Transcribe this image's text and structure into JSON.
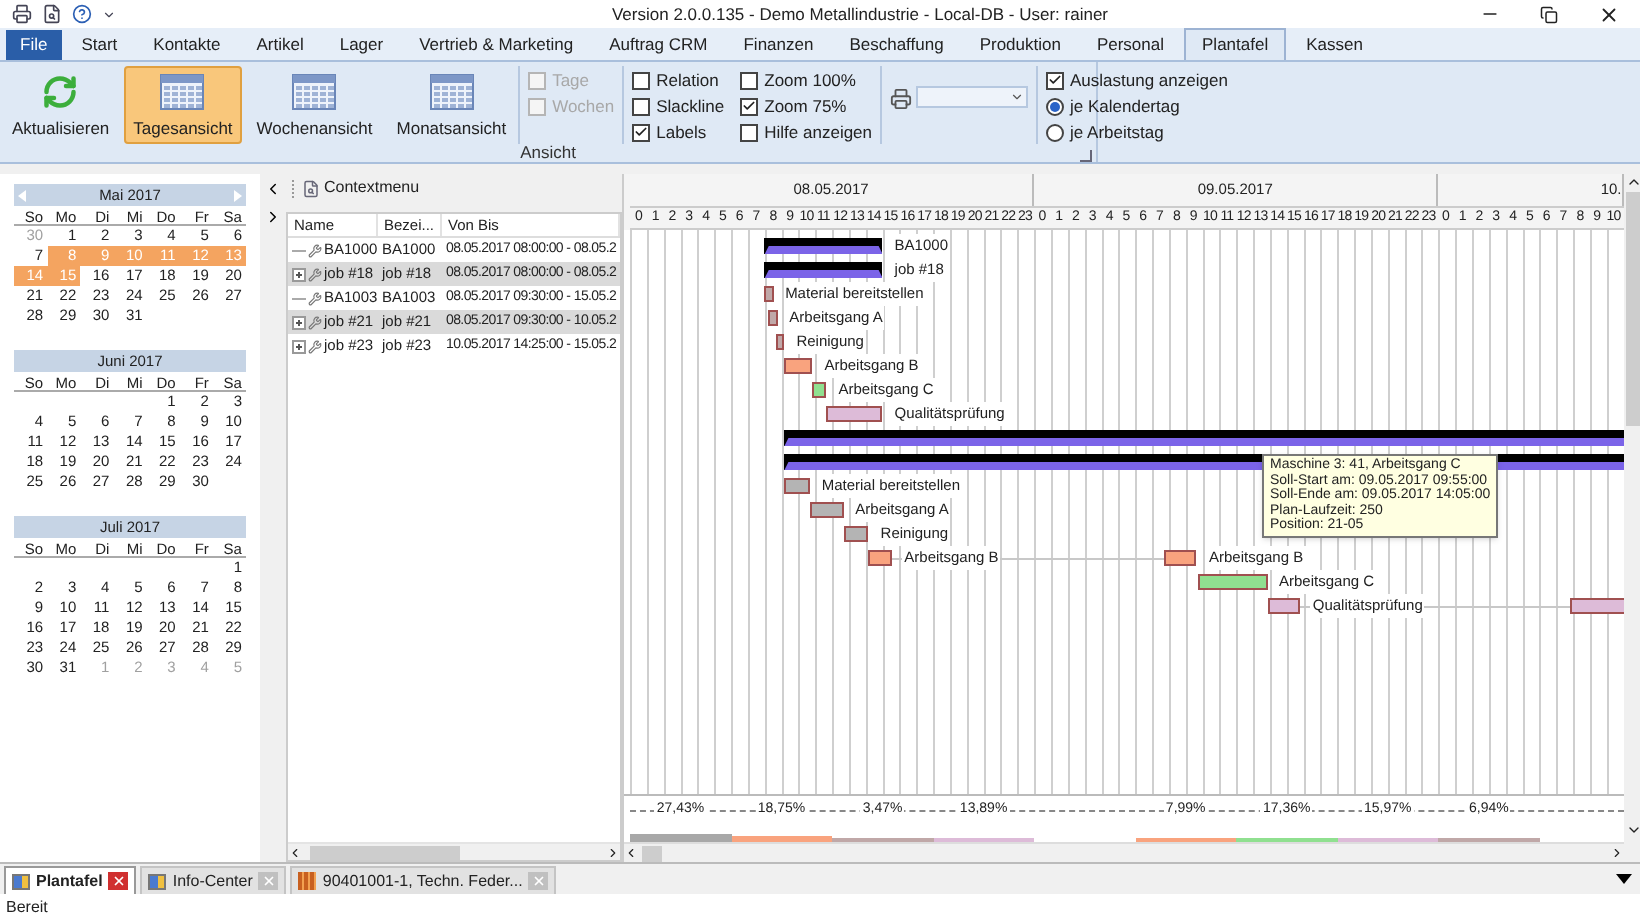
{
  "window": {
    "title": "Version 2.0.0.135 - Demo Metallindustrie - Local-DB - User: rainer"
  },
  "menu_tabs": [
    {
      "label": "File",
      "kind": "file",
      "selected": false
    },
    {
      "label": "Start",
      "kind": "tab",
      "selected": false
    },
    {
      "label": "Kontakte",
      "kind": "tab",
      "selected": false
    },
    {
      "label": "Artikel",
      "kind": "tab",
      "selected": false
    },
    {
      "label": "Lager",
      "kind": "tab",
      "selected": false
    },
    {
      "label": "Vertrieb & Marketing",
      "kind": "tab",
      "selected": false
    },
    {
      "label": "Auftrag CRM",
      "kind": "tab",
      "selected": false
    },
    {
      "label": "Finanzen",
      "kind": "tab",
      "selected": false
    },
    {
      "label": "Beschaffung",
      "kind": "tab",
      "selected": false
    },
    {
      "label": "Produktion",
      "kind": "tab",
      "selected": false
    },
    {
      "label": "Personal",
      "kind": "tab",
      "selected": false
    },
    {
      "label": "Plantafel",
      "kind": "tab",
      "selected": true
    },
    {
      "label": "Kassen",
      "kind": "tab",
      "selected": false
    }
  ],
  "ribbon": {
    "group_label": "Ansicht",
    "buttons": [
      {
        "label": "Aktualisieren",
        "kind": "refresh",
        "selected": false
      },
      {
        "label": "Tagesansicht",
        "kind": "calendar",
        "selected": true
      },
      {
        "label": "Wochenansicht",
        "kind": "calendar",
        "selected": false
      },
      {
        "label": "Monatsansicht",
        "kind": "calendar",
        "selected": false
      }
    ],
    "checkbox_columns": [
      [
        {
          "label": "Tage",
          "checked": false,
          "disabled": true
        },
        {
          "label": "Wochen",
          "checked": false,
          "disabled": true
        }
      ],
      [
        {
          "label": "Relation",
          "checked": false,
          "disabled": false
        },
        {
          "label": "Slackline",
          "checked": false,
          "disabled": false
        },
        {
          "label": "Labels",
          "checked": true,
          "disabled": false
        }
      ],
      [
        {
          "label": "Zoom 100%",
          "checked": false,
          "disabled": false
        },
        {
          "label": "Zoom 75%",
          "checked": true,
          "disabled": false
        },
        {
          "label": "Hilfe anzeigen",
          "checked": false,
          "disabled": false
        }
      ]
    ],
    "utilization": {
      "label": "Auslastung anzeigen",
      "checked": true
    },
    "radios": [
      {
        "label": "je Kalendertag",
        "selected": true
      },
      {
        "label": "je Arbeitstag",
        "selected": false
      }
    ]
  },
  "calendar": [
    {
      "title": "Mai 2017",
      "navigation": true,
      "weekdays": [
        "So",
        "Mo",
        "Di",
        "Mi",
        "Do",
        "Fr",
        "Sa"
      ],
      "weeks": [
        [
          {
            "day": "30",
            "muted": true,
            "selected": false
          },
          {
            "day": "1",
            "muted": false,
            "selected": false
          },
          {
            "day": "2",
            "muted": false,
            "selected": false
          },
          {
            "day": "3",
            "muted": false,
            "selected": false
          },
          {
            "day": "4",
            "muted": false,
            "selected": false
          },
          {
            "day": "5",
            "muted": false,
            "selected": false
          },
          {
            "day": "6",
            "muted": false,
            "selected": false
          }
        ],
        [
          {
            "day": "7",
            "muted": false,
            "selected": false
          },
          {
            "day": "8",
            "muted": false,
            "selected": true
          },
          {
            "day": "9",
            "muted": false,
            "selected": true
          },
          {
            "day": "10",
            "muted": false,
            "selected": true
          },
          {
            "day": "11",
            "muted": false,
            "selected": true
          },
          {
            "day": "12",
            "muted": false,
            "selected": true
          },
          {
            "day": "13",
            "muted": false,
            "selected": true
          }
        ],
        [
          {
            "day": "14",
            "muted": false,
            "selected": true
          },
          {
            "day": "15",
            "muted": false,
            "selected": true
          },
          {
            "day": "16",
            "muted": false,
            "selected": false
          },
          {
            "day": "17",
            "muted": false,
            "selected": false
          },
          {
            "day": "18",
            "muted": false,
            "selected": false
          },
          {
            "day": "19",
            "muted": false,
            "selected": false
          },
          {
            "day": "20",
            "muted": false,
            "selected": false
          }
        ],
        [
          {
            "day": "21",
            "muted": false,
            "selected": false
          },
          {
            "day": "22",
            "muted": false,
            "selected": false
          },
          {
            "day": "23",
            "muted": false,
            "selected": false
          },
          {
            "day": "24",
            "muted": false,
            "selected": false
          },
          {
            "day": "25",
            "muted": false,
            "selected": false
          },
          {
            "day": "26",
            "muted": false,
            "selected": false
          },
          {
            "day": "27",
            "muted": false,
            "selected": false
          }
        ],
        [
          {
            "day": "28",
            "muted": false,
            "selected": false
          },
          {
            "day": "29",
            "muted": false,
            "selected": false
          },
          {
            "day": "30",
            "muted": false,
            "selected": false
          },
          {
            "day": "31",
            "muted": false,
            "selected": false
          }
        ]
      ]
    },
    {
      "title": "Juni 2017",
      "navigation": false,
      "weekdays": [
        "So",
        "Mo",
        "Di",
        "Mi",
        "Do",
        "Fr",
        "Sa"
      ],
      "weeks": [
        [
          {
            "day": "1",
            "muted": false,
            "selected": false
          },
          {
            "day": "2",
            "muted": false,
            "selected": false
          },
          {
            "day": "3",
            "muted": false,
            "selected": false
          }
        ],
        [
          {
            "day": "4",
            "muted": false,
            "selected": false
          },
          {
            "day": "5",
            "muted": false,
            "selected": false
          },
          {
            "day": "6",
            "muted": false,
            "selected": false
          },
          {
            "day": "7",
            "muted": false,
            "selected": false
          },
          {
            "day": "8",
            "muted": false,
            "selected": false
          },
          {
            "day": "9",
            "muted": false,
            "selected": false
          },
          {
            "day": "10",
            "muted": false,
            "selected": false
          }
        ],
        [
          {
            "day": "11",
            "muted": false,
            "selected": false
          },
          {
            "day": "12",
            "muted": false,
            "selected": false
          },
          {
            "day": "13",
            "muted": false,
            "selected": false
          },
          {
            "day": "14",
            "muted": false,
            "selected": false
          },
          {
            "day": "15",
            "muted": false,
            "selected": false
          },
          {
            "day": "16",
            "muted": false,
            "selected": false
          },
          {
            "day": "17",
            "muted": false,
            "selected": false
          }
        ],
        [
          {
            "day": "18",
            "muted": false,
            "selected": false
          },
          {
            "day": "19",
            "muted": false,
            "selected": false
          },
          {
            "day": "20",
            "muted": false,
            "selected": false
          },
          {
            "day": "21",
            "muted": false,
            "selected": false
          },
          {
            "day": "22",
            "muted": false,
            "selected": false
          },
          {
            "day": "23",
            "muted": false,
            "selected": false
          },
          {
            "day": "24",
            "muted": false,
            "selected": false
          }
        ],
        [
          {
            "day": "25",
            "muted": false,
            "selected": false
          },
          {
            "day": "26",
            "muted": false,
            "selected": false
          },
          {
            "day": "27",
            "muted": false,
            "selected": false
          },
          {
            "day": "28",
            "muted": false,
            "selected": false
          },
          {
            "day": "29",
            "muted": false,
            "selected": false
          },
          {
            "day": "30",
            "muted": false,
            "selected": false
          }
        ]
      ]
    },
    {
      "title": "Juli 2017",
      "navigation": false,
      "weekdays": [
        "So",
        "Mo",
        "Di",
        "Mi",
        "Do",
        "Fr",
        "Sa"
      ],
      "weeks": [
        [
          {
            "day": "1",
            "muted": false,
            "selected": false
          }
        ],
        [
          {
            "day": "2",
            "muted": false,
            "selected": false
          },
          {
            "day": "3",
            "muted": false,
            "selected": false
          },
          {
            "day": "4",
            "muted": false,
            "selected": false
          },
          {
            "day": "5",
            "muted": false,
            "selected": false
          },
          {
            "day": "6",
            "muted": false,
            "selected": false
          },
          {
            "day": "7",
            "muted": false,
            "selected": false
          },
          {
            "day": "8",
            "muted": false,
            "selected": false
          }
        ],
        [
          {
            "day": "9",
            "muted": false,
            "selected": false
          },
          {
            "day": "10",
            "muted": false,
            "selected": false
          },
          {
            "day": "11",
            "muted": false,
            "selected": false
          },
          {
            "day": "12",
            "muted": false,
            "selected": false
          },
          {
            "day": "13",
            "muted": false,
            "selected": false
          },
          {
            "day": "14",
            "muted": false,
            "selected": false
          },
          {
            "day": "15",
            "muted": false,
            "selected": false
          }
        ],
        [
          {
            "day": "16",
            "muted": false,
            "selected": false
          },
          {
            "day": "17",
            "muted": false,
            "selected": false
          },
          {
            "day": "18",
            "muted": false,
            "selected": false
          },
          {
            "day": "19",
            "muted": false,
            "selected": false
          },
          {
            "day": "20",
            "muted": false,
            "selected": false
          },
          {
            "day": "21",
            "muted": false,
            "selected": false
          },
          {
            "day": "22",
            "muted": false,
            "selected": false
          }
        ],
        [
          {
            "day": "23",
            "muted": false,
            "selected": false
          },
          {
            "day": "24",
            "muted": false,
            "selected": false
          },
          {
            "day": "25",
            "muted": false,
            "selected": false
          },
          {
            "day": "26",
            "muted": false,
            "selected": false
          },
          {
            "day": "27",
            "muted": false,
            "selected": false
          },
          {
            "day": "28",
            "muted": false,
            "selected": false
          },
          {
            "day": "29",
            "muted": false,
            "selected": false
          }
        ],
        [
          {
            "day": "30",
            "muted": false,
            "selected": false
          },
          {
            "day": "31",
            "muted": false,
            "selected": false
          },
          {
            "day": "1",
            "muted": true,
            "selected": false
          },
          {
            "day": "2",
            "muted": true,
            "selected": false
          },
          {
            "day": "3",
            "muted": true,
            "selected": false
          },
          {
            "day": "4",
            "muted": true,
            "selected": false
          },
          {
            "day": "5",
            "muted": true,
            "selected": false
          }
        ]
      ]
    }
  ],
  "tree": {
    "toolbar": "Contextmenu",
    "columns": [
      "Name",
      "Bezei...",
      "Von Bis"
    ],
    "rows": [
      {
        "name": "BA1000",
        "label": "BA1000",
        "period": "08.05.2017 08:00:00 - 08.05.2",
        "expandable": false,
        "selected": false
      },
      {
        "name": "job #18",
        "label": "job #18",
        "period": "08.05.2017 08:00:00 - 08.05.2",
        "expandable": true,
        "selected": true
      },
      {
        "name": "BA1003",
        "label": "BA1003",
        "period": "08.05.2017 09:30:00 - 15.05.2",
        "expandable": false,
        "selected": false
      },
      {
        "name": "job #21",
        "label": "job #21",
        "period": "08.05.2017 09:30:00 - 10.05.2",
        "expandable": true,
        "selected": true
      },
      {
        "name": "job #23",
        "label": "job #23",
        "period": "10.05.2017 14:25:00 - 15.05.2",
        "expandable": true,
        "selected": false
      }
    ]
  },
  "gantt": {
    "timeline": [
      {
        "date": "08.05.2017",
        "hours": [
          "0",
          "1",
          "2",
          "3",
          "4",
          "5",
          "6",
          "7",
          "8",
          "9",
          "10",
          "11",
          "12",
          "13",
          "14",
          "15",
          "16",
          "17",
          "18",
          "19",
          "20",
          "21",
          "22",
          "23"
        ]
      },
      {
        "date": "09.05.2017",
        "hours": [
          "0",
          "1",
          "2",
          "3",
          "4",
          "5",
          "6",
          "7",
          "8",
          "9",
          "10",
          "11",
          "12",
          "13",
          "14",
          "15",
          "16",
          "17",
          "18",
          "19",
          "20",
          "21",
          "22",
          "23"
        ]
      },
      {
        "date": "10.",
        "hours": [
          "0",
          "1",
          "2",
          "3",
          "4",
          "5",
          "6",
          "7",
          "8",
          "9",
          "10"
        ]
      }
    ],
    "rows": [
      {
        "bars": [
          {
            "kind": "summary",
            "label": "BA1000"
          }
        ]
      },
      {
        "bars": [
          {
            "kind": "summary",
            "label": "job #18"
          }
        ]
      },
      {
        "bars": [
          {
            "kind": "task",
            "color": "#c0a8a8",
            "label": "Material bereitstellen"
          }
        ]
      },
      {
        "bars": [
          {
            "kind": "task",
            "color": "#c0a8a8",
            "label": "Arbeitsgang A"
          }
        ]
      },
      {
        "bars": [
          {
            "kind": "task",
            "color": "#c0a8a8",
            "label": "Reinigung"
          }
        ]
      },
      {
        "bars": [
          {
            "kind": "task",
            "color": "#f9a37e",
            "label": "Arbeitsgang B"
          }
        ]
      },
      {
        "bars": [
          {
            "kind": "task",
            "color": "#90e090",
            "label": "Arbeitsgang C"
          }
        ]
      },
      {
        "bars": [
          {
            "kind": "task",
            "color": "#ddbbd8",
            "label": "Qualitätsprüfung"
          }
        ]
      },
      {
        "bars": [
          {
            "kind": "summary"
          }
        ]
      },
      {
        "bars": [
          {
            "kind": "summary"
          }
        ]
      },
      {
        "bars": [
          {
            "kind": "task",
            "color": "#b4b4b4",
            "label": "Material bereitstellen"
          }
        ]
      },
      {
        "bars": [
          {
            "kind": "task",
            "color": "#b4b4b4",
            "label": "Arbeitsgang A"
          }
        ]
      },
      {
        "bars": [
          {
            "kind": "task",
            "color": "#b4b4b4",
            "label": "Reinigung"
          }
        ]
      },
      {
        "bars": [
          {
            "kind": "task",
            "color": "#f9a37e",
            "label": "Arbeitsgang B"
          },
          {
            "kind": "task",
            "color": "#f9a37e",
            "label": "Arbeitsgang B"
          }
        ]
      },
      {
        "bars": [
          {
            "kind": "task",
            "color": "#90e090",
            "label": "Arbeitsgang C"
          }
        ]
      },
      {
        "bars": [
          {
            "kind": "task",
            "color": "#ddbbd8",
            "label": "Qualitätsprüfung"
          },
          {
            "kind": "task",
            "color": "#ddbbd8"
          }
        ]
      }
    ],
    "tooltip": [
      "Maschine 3: 41, Arbeitsgang C",
      "Soll-Start am: 09.05.2017 09:55:00",
      "Soll-Ende am: 09.05.2017 14:05:00",
      "Plan-Laufzeit: 250",
      "Position: 21-05"
    ],
    "utilization": [
      {
        "value": "27,43%",
        "color": "#a8a8a8"
      },
      {
        "value": "18,75%",
        "color": "#f9a37e"
      },
      {
        "value": "3,47%",
        "color": "#c0a8a8"
      },
      {
        "value": "13,89%",
        "color": "#ddbbd8"
      },
      {
        "value": "7,99%",
        "color": "#f9a37e"
      },
      {
        "value": "17,36%",
        "color": "#90e090"
      },
      {
        "value": "15,97%",
        "color": "#ddbbd8"
      },
      {
        "value": "6,94%",
        "color": "#c0a8a8"
      }
    ]
  },
  "document_tabs": [
    {
      "label": "Plantafel",
      "kind": "board",
      "selected": true
    },
    {
      "label": "Info-Center",
      "kind": "board",
      "selected": false
    },
    {
      "label": "90401001-1, Techn. Feder...",
      "kind": "article",
      "selected": false
    }
  ],
  "status_bar": "Bereit"
}
